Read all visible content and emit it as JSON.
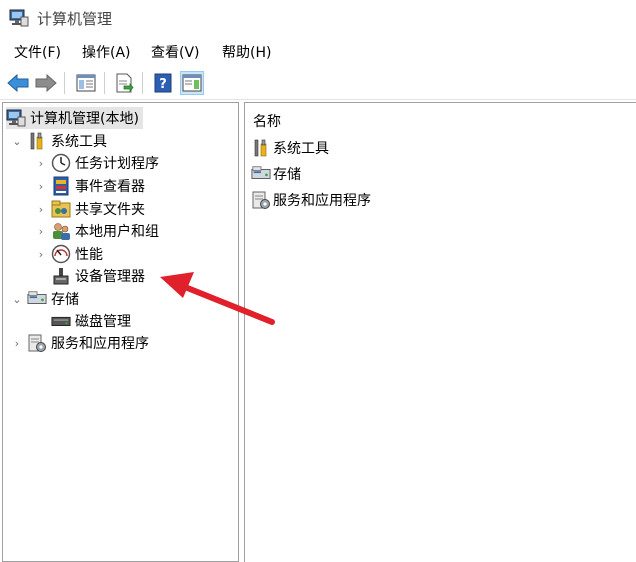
{
  "window": {
    "title": "计算机管理"
  },
  "menu": [
    "文件(F)",
    "操作(A)",
    "查看(V)",
    "帮助(H)"
  ],
  "toolbar": {
    "buttons": [
      "back-icon",
      "forward-icon",
      "show-hide-tree-icon",
      "export-list-icon",
      "help-icon",
      "show-hide-action-pane-icon"
    ]
  },
  "tree": {
    "root": "计算机管理(本地)",
    "system_tools": {
      "label": "系统工具",
      "children": [
        "任务计划程序",
        "事件查看器",
        "共享文件夹",
        "本地用户和组",
        "性能",
        "设备管理器"
      ]
    },
    "storage": {
      "label": "存储",
      "children": [
        "磁盘管理"
      ]
    },
    "services": {
      "label": "服务和应用程序"
    }
  },
  "list": {
    "header": "名称",
    "items": [
      "系统工具",
      "存储",
      "服务和应用程序"
    ]
  },
  "colors": {
    "accent_arrow": "#e0202a",
    "selection": "#e5e5e5"
  }
}
